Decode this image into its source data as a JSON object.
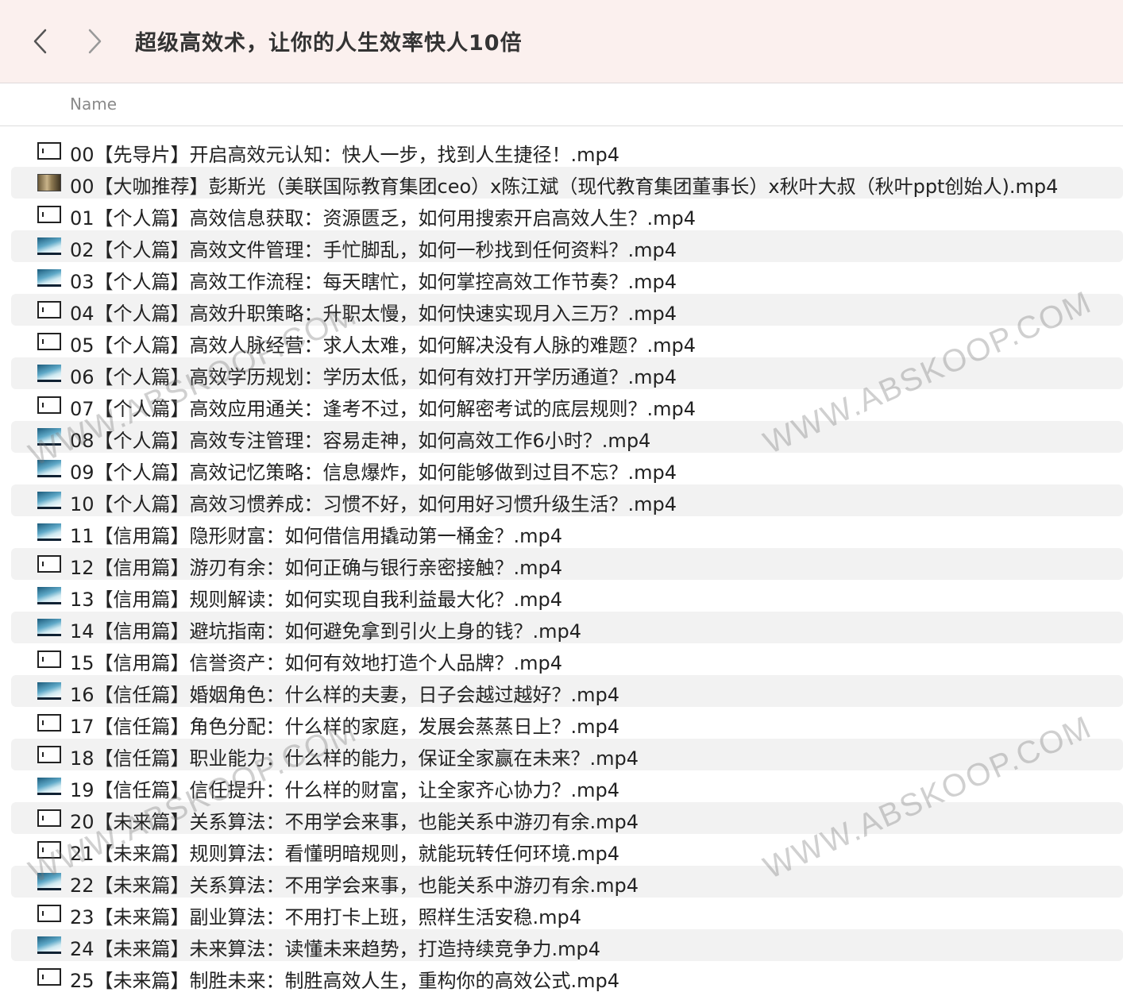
{
  "toolbar": {
    "title": "超级高效术，让你的人生效率快人10倍",
    "back_icon": "chevron-left-icon",
    "forward_icon": "chevron-right-icon"
  },
  "header": {
    "name_label": "Name"
  },
  "files": [
    {
      "name": "00【先导片】开启高效元认知：快人一步，找到人生捷径！.mp4",
      "thumb": "dark"
    },
    {
      "name": "00【大咖推荐】彭斯光（美联国际教育集团ceo）x陈江斌（现代教育集团董事长）x秋叶大叔（秋叶ppt创始人).mp4",
      "thumb": "photo"
    },
    {
      "name": "01【个人篇】高效信息获取：资源匮乏，如何用搜索开启高效人生？.mp4",
      "thumb": "dark"
    },
    {
      "name": "02【个人篇】高效文件管理：手忙脚乱，如何一秒找到任何资料？.mp4",
      "thumb": "blue"
    },
    {
      "name": "03【个人篇】高效工作流程：每天瞎忙，如何掌控高效工作节奏？.mp4",
      "thumb": "blue"
    },
    {
      "name": "04【个人篇】高效升职策略：升职太慢，如何快速实现月入三万？.mp4",
      "thumb": "dark"
    },
    {
      "name": "05【个人篇】高效人脉经营：求人太难，如何解决没有人脉的难题？.mp4",
      "thumb": "dark"
    },
    {
      "name": "06【个人篇】高效学历规划：学历太低，如何有效打开学历通道？.mp4",
      "thumb": "blue"
    },
    {
      "name": "07【个人篇】高效应用通关：逢考不过，如何解密考试的底层规则？.mp4",
      "thumb": "dark"
    },
    {
      "name": "08【个人篇】高效专注管理：容易走神，如何高效工作6小时？.mp4",
      "thumb": "blue"
    },
    {
      "name": "09【个人篇】高效记忆策略：信息爆炸，如何能够做到过目不忘？.mp4",
      "thumb": "blue"
    },
    {
      "name": "10【个人篇】高效习惯养成：习惯不好，如何用好习惯升级生活？.mp4",
      "thumb": "blue"
    },
    {
      "name": "11【信用篇】隐形财富：如何借信用撬动第一桶金？.mp4",
      "thumb": "blue"
    },
    {
      "name": "12【信用篇】游刃有余：如何正确与银行亲密接触？.mp4",
      "thumb": "dark"
    },
    {
      "name": "13【信用篇】规则解读：如何实现自我利益最大化？.mp4",
      "thumb": "blue"
    },
    {
      "name": "14【信用篇】避坑指南：如何避免拿到引火上身的钱？.mp4",
      "thumb": "blue"
    },
    {
      "name": "15【信用篇】信誉资产：如何有效地打造个人品牌？.mp4",
      "thumb": "dark"
    },
    {
      "name": "16【信任篇】婚姻角色：什么样的夫妻，日子会越过越好？.mp4",
      "thumb": "blue"
    },
    {
      "name": "17【信任篇】角色分配：什么样的家庭，发展会蒸蒸日上？.mp4",
      "thumb": "dark"
    },
    {
      "name": "18【信任篇】职业能力：什么样的能力，保证全家赢在未来？.mp4",
      "thumb": "dark"
    },
    {
      "name": "19【信任篇】信任提升：什么样的财富，让全家齐心协力？.mp4",
      "thumb": "blue"
    },
    {
      "name": "20【未来篇】关系算法：不用学会来事，也能关系中游刃有余.mp4",
      "thumb": "dark"
    },
    {
      "name": "21【未来篇】规则算法：看懂明暗规则，就能玩转任何环境.mp4",
      "thumb": "dark"
    },
    {
      "name": "22【未来篇】关系算法：不用学会来事，也能关系中游刃有余.mp4",
      "thumb": "blue"
    },
    {
      "name": "23【未来篇】副业算法：不用打卡上班，照样生活安稳.mp4",
      "thumb": "dark"
    },
    {
      "name": "24【未来篇】未来算法：读懂未来趋势，打造持续竞争力.mp4",
      "thumb": "blue"
    },
    {
      "name": "25【未来篇】制胜未来：制胜高效人生，重构你的高效公式.mp4",
      "thumb": "dark"
    }
  ],
  "watermark": {
    "text": "WWW.ABSKOOP.COM"
  }
}
